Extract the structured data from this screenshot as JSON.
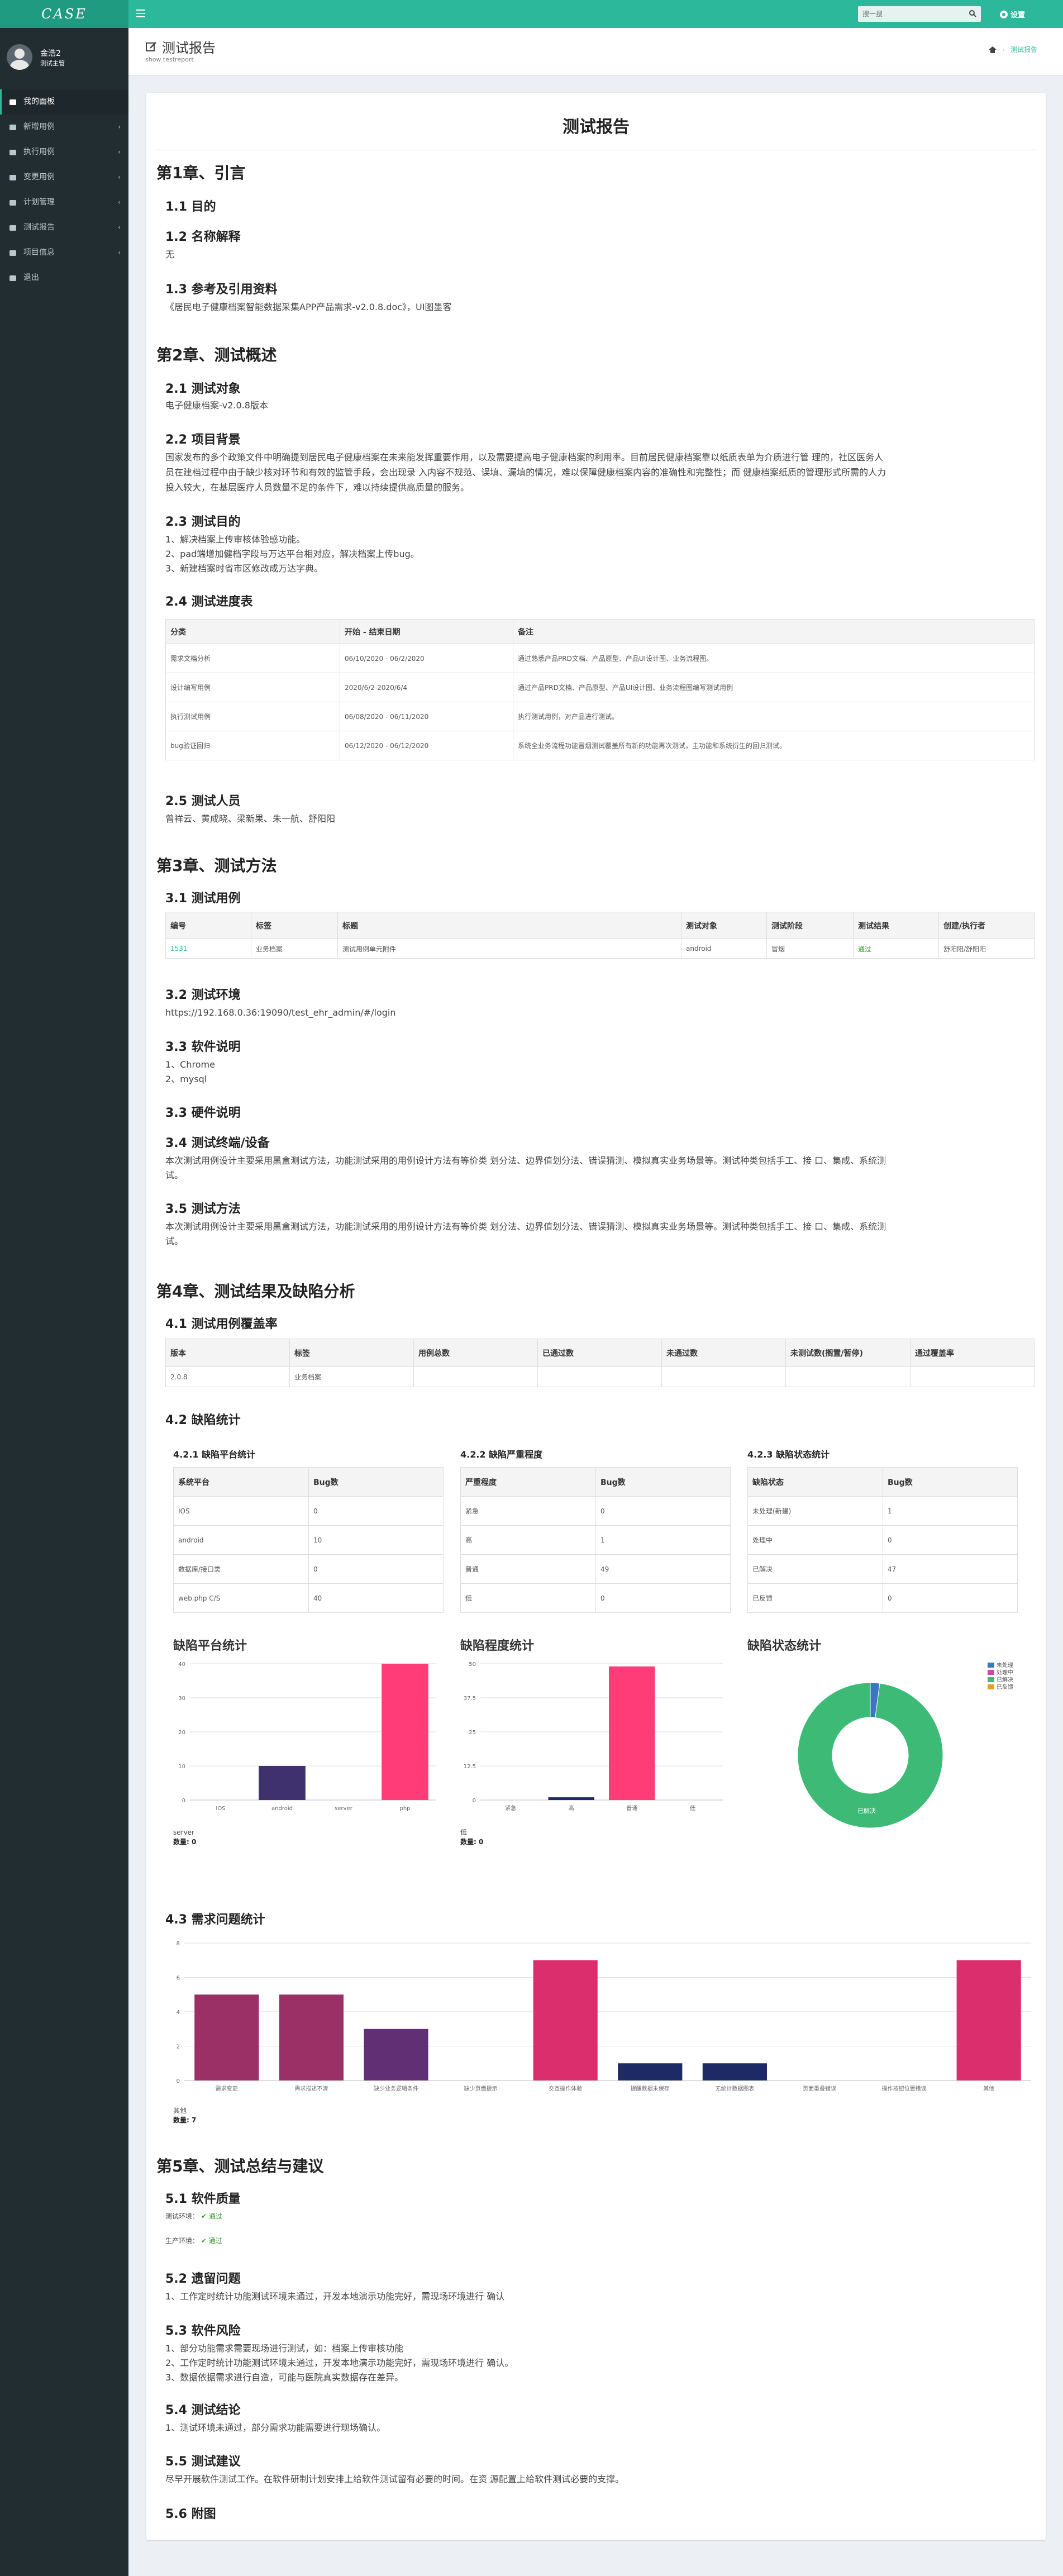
{
  "app": {
    "logo": "CASE",
    "search_placeholder": "搜一搜",
    "settings_label": "设置"
  },
  "user": {
    "name": "金浩2",
    "role": "测试主管"
  },
  "menu": [
    {
      "label": "我的面板",
      "icon": "dashboard-icon",
      "active": true,
      "arrow": ""
    },
    {
      "label": "新增用例",
      "icon": "plus-square-icon",
      "active": false,
      "arrow": "‹"
    },
    {
      "label": "执行用例",
      "icon": "edit-icon",
      "active": false,
      "arrow": "‹"
    },
    {
      "label": "变更用例",
      "icon": "edit-icon",
      "active": false,
      "arrow": "‹"
    },
    {
      "label": "计划管理",
      "icon": "folder-icon",
      "active": false,
      "arrow": "‹"
    },
    {
      "label": "测试报告",
      "icon": "book-icon",
      "active": false,
      "arrow": "‹"
    },
    {
      "label": "项目信息",
      "icon": "wrench-icon",
      "active": false,
      "arrow": "‹"
    },
    {
      "label": "退出",
      "icon": "sign-out-icon",
      "active": false,
      "arrow": ""
    }
  ],
  "page": {
    "title": "测试报告",
    "subtitle": "show testreport",
    "breadcrumb": "测试报告"
  },
  "report": {
    "title": "测试报告",
    "ch1": {
      "title": "第1章、引言",
      "s1": "1.1 目的",
      "s2": "1.2 名称解释",
      "s2_text": "无",
      "s3": "1.3 参考及引用资料",
      "s3_text": "《居民电子健康档案智能数据采集APP产品需求-v2.0.8.doc》，UI图墨客"
    },
    "ch2": {
      "title": "第2章、测试概述",
      "s1": "2.1 测试对象",
      "s1_text": "电子健康档案-v2.0.8版本",
      "s2": "2.2 项目背景",
      "s2_l1": "国家发布的多个政策文件中明确提到居民电子健康档案在未来能发挥重要作用，以及需要提高电子健康档案的利用率。目前居民健康档案靠以纸质表单为介质进行管 理的，社区医务人",
      "s2_l2": "员在建档过程中由于缺少核对环节和有效的监管手段，会出现录 入内容不规范、误填、漏填的情况，难以保障健康档案内容的准确性和完整性；而 健康档案纸质的管理形式所需的人力",
      "s2_l3": "投入较大，在基层医疗人员数量不足的条件下，难以持续提供高质量的服务。",
      "s3": "2.3 测试目的",
      "s3_l1": "1、解决档案上传审核体验感功能。",
      "s3_l2": "2、pad端增加健档字段与万达平台相对应，解决档案上传bug。",
      "s3_l3": "3、新建档案时省市区修改成万达字典。",
      "s4": "2.4 测试进度表",
      "schedule_headers": [
        "分类",
        "开始 - 结束日期",
        "备注"
      ],
      "schedule_rows": [
        [
          "需求文档分析",
          "06/10/2020 - 06/2/2020",
          "通过熟悉产品PRD文档、产品原型、产品UI设计图、业务流程图。"
        ],
        [
          "设计编写用例",
          "2020/6/2-2020/6/4",
          "通过产品PRD文档、产品原型、产品UI设计图、业务流程图编写测试用例"
        ],
        [
          "执行测试用例",
          "06/08/2020 - 06/11/2020",
          "执行测试用例，对产品进行测试。"
        ],
        [
          "bug验证回归",
          "06/12/2020 - 06/12/2020",
          "系统全业务流程功能冒烟测试覆盖所有新的功能再次测试，主功能和系统衍生的回归测试。"
        ]
      ],
      "s5": "2.5 测试人员",
      "s5_text": "曾祥云、黄成晓、梁新果、朱一航、舒阳阳"
    },
    "ch3": {
      "title": "第3章、测试方法",
      "s1": "3.1 测试用例",
      "case_headers": [
        "编号",
        "标签",
        "标题",
        "测试对象",
        "测试阶段",
        "测试结果",
        "创建/执行者"
      ],
      "case_row": [
        "1531",
        "业务档案",
        "测试用例单元附件",
        "android",
        "冒烟",
        "通过",
        "舒阳阳/舒阳阳"
      ],
      "s2": "3.2 测试环境",
      "s2_text": "https://192.168.0.36:19090/test_ehr_admin/#/login",
      "s3": "3.3 软件说明",
      "s3_l1": "1、Chrome",
      "s3_l2": "2、mysql",
      "s4": "3.3 硬件说明",
      "s5": "3.4 测试终端/设备",
      "s5_l1": "本次测试用例设计主要采用黑盒测试方法，功能测试采用的用例设计方法有等价类 划分法、边界值划分法、错误猜测、模拟真实业务场景等。测试种类包括手工、接 口、集成、系统测",
      "s5_l2": "试。",
      "s6": "3.5 测试方法",
      "s6_l1": "本次测试用例设计主要采用黑盒测试方法，功能测试采用的用例设计方法有等价类 划分法、边界值划分法、错误猜测、模拟真实业务场景等。测试种类包括手工、接 口、集成、系统测",
      "s6_l2": "试。"
    },
    "ch4": {
      "title": "第4章、测试结果及缺陷分析",
      "s1": "4.1 测试用例覆盖率",
      "cov_headers": [
        "版本",
        "标签",
        "用例总数",
        "已通过数",
        "未通过数",
        "未测试数(搁置/暂停)",
        "通过覆盖率"
      ],
      "cov_row": [
        "2.0.8",
        "业务档案",
        "",
        "",
        "",
        "",
        ""
      ],
      "s2": "4.2 缺陷统计",
      "t1_title": "4.2.1 缺陷平台统计",
      "t1_headers": [
        "系统平台",
        "Bug数"
      ],
      "t1_rows": [
        [
          "IOS",
          "0"
        ],
        [
          "android",
          "10"
        ],
        [
          "数据库/接口类",
          "0"
        ],
        [
          "web.php C/S",
          "40"
        ]
      ],
      "t2_title": "4.2.2 缺陷严重程度",
      "t2_headers": [
        "严重程度",
        "Bug数"
      ],
      "t2_rows": [
        [
          "紧急",
          "0"
        ],
        [
          "高",
          "1"
        ],
        [
          "普通",
          "49"
        ],
        [
          "低",
          "0"
        ]
      ],
      "t3_title": "4.2.3 缺陷状态统计",
      "t3_headers": [
        "缺陷状态",
        "Bug数"
      ],
      "t3_rows": [
        [
          "未处理(新建)",
          "1"
        ],
        [
          "处理中",
          "0"
        ],
        [
          "已解决",
          "47"
        ],
        [
          "已反馈",
          "0"
        ]
      ],
      "c1_footer_name": "server",
      "c1_footer_count": "数量: 0",
      "c2_footer_name": "低",
      "c2_footer_count": "数量: 0",
      "s3": "4.3 需求问题统计",
      "c4_footer_name": "其他",
      "c4_footer_count": "数量: 7"
    },
    "ch5": {
      "title": "第5章、测试总结与建议",
      "s1": "5.1 软件质量",
      "env1_label": "测试环境：",
      "env1_status": "通过",
      "env2_label": "生产环境：",
      "env2_status": "通过",
      "s2": "5.2 遗留问题",
      "s2_text": "1、工作定时统计功能测试环境未通过，开发本地演示功能完好，需现场环境进行 确认",
      "s3": "5.3 软件风险",
      "s3_l1": "1、部分功能需求需要现场进行测试，如：档案上传审核功能",
      "s3_l2": "2、工作定时统计功能测试环境未通过，开发本地演示功能完好，需现场环境进行 确认。",
      "s3_l3": "3、数据依据需求进行自造，可能与医院真实数据存在差异。",
      "s4": "5.4 测试结论",
      "s4_text": "1、测试环境未通过，部分需求功能需要进行现场确认。",
      "s5": "5.5 测试建议",
      "s5_text": "尽早开展软件测试工作。在软件研制计划安排上给软件测试留有必要的时间。在资 源配置上给软件测试必要的支撑。",
      "s6": "5.6 附图"
    }
  },
  "chart_data": [
    {
      "type": "bar",
      "title": "缺陷平台统计",
      "categories": [
        "IOS",
        "android",
        "server",
        "php"
      ],
      "values": [
        0,
        10,
        0,
        40
      ],
      "colors": [
        "#3f316e",
        "#3f316e",
        "#3f316e",
        "#ff3b78"
      ],
      "ylim": [
        0,
        40
      ],
      "yticks": [
        0,
        10,
        20,
        30,
        40
      ]
    },
    {
      "type": "bar",
      "title": "缺陷程度统计",
      "categories": [
        "紧急",
        "高",
        "普通",
        "低"
      ],
      "values": [
        0,
        1,
        49,
        0
      ],
      "colors": [
        "#202c5e",
        "#202c5e",
        "#ff3b78",
        "#202c5e"
      ],
      "ylim": [
        0,
        50
      ],
      "yticks": [
        "0",
        "12.5",
        "25",
        "37.5",
        "50"
      ]
    },
    {
      "type": "pie",
      "title": "缺陷状态统计",
      "categories": [
        "未处理",
        "处理中",
        "已解决",
        "已反馈"
      ],
      "values": [
        1,
        0,
        47,
        0
      ],
      "colors": [
        "#3a76c4",
        "#c24bb0",
        "#3dbb76",
        "#e0a030"
      ],
      "labels": {
        "已解决": "已解决"
      }
    },
    {
      "type": "bar",
      "title": "需求问题统计",
      "categories": [
        "需求变更",
        "需求描述不清",
        "缺少业务逻辑条件",
        "缺少页面提示",
        "交互操作体验",
        "提醒数据未保存",
        "无统计数据图表",
        "页面重叠错误",
        "操作按钮位置错误",
        "其他"
      ],
      "values": [
        5,
        5,
        3,
        0,
        7,
        1,
        1,
        0,
        0,
        7
      ],
      "colors": [
        "#9b3067",
        "#9b3067",
        "#612f74",
        "#612f74",
        "#db2e6c",
        "#1d2a66",
        "#1d2a66",
        "#1d2a66",
        "#1d2a66",
        "#db2e6c"
      ],
      "ylim": [
        0,
        8
      ],
      "yticks": [
        0,
        2,
        4,
        6,
        8
      ]
    }
  ]
}
